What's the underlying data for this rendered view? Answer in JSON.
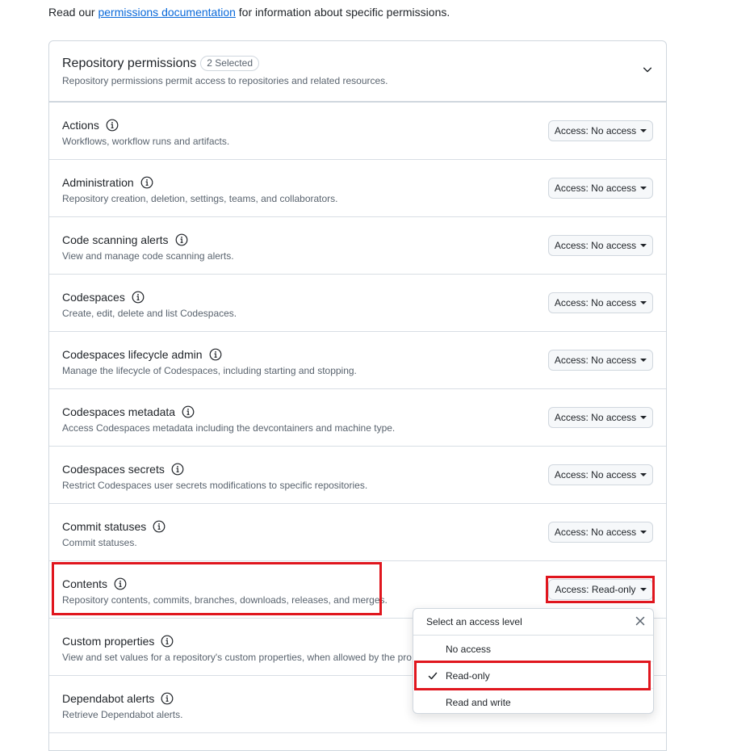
{
  "intro": {
    "before": "Read our ",
    "link": "permissions documentation",
    "after": " for information about specific permissions."
  },
  "panel": {
    "title": "Repository permissions",
    "badge": "2 Selected",
    "subtitle": "Repository permissions permit access to repositories and related resources."
  },
  "rows": [
    {
      "name": "Actions",
      "desc": "Workflows, workflow runs and artifacts.",
      "access": "Access: No access"
    },
    {
      "name": "Administration",
      "desc": "Repository creation, deletion, settings, teams, and collaborators.",
      "access": "Access: No access"
    },
    {
      "name": "Code scanning alerts",
      "desc": "View and manage code scanning alerts.",
      "access": "Access: No access"
    },
    {
      "name": "Codespaces",
      "desc": "Create, edit, delete and list Codespaces.",
      "access": "Access: No access"
    },
    {
      "name": "Codespaces lifecycle admin",
      "desc": "Manage the lifecycle of Codespaces, including starting and stopping.",
      "access": "Access: No access"
    },
    {
      "name": "Codespaces metadata",
      "desc": "Access Codespaces metadata including the devcontainers and machine type.",
      "access": "Access: No access"
    },
    {
      "name": "Codespaces secrets",
      "desc": "Restrict Codespaces user secrets modifications to specific repositories.",
      "access": "Access: No access"
    },
    {
      "name": "Commit statuses",
      "desc": "Commit statuses.",
      "access": "Access: No access"
    },
    {
      "name": "Contents",
      "desc": "Repository contents, commits, branches, downloads, releases, and merges.",
      "access": "Access: Read-only"
    },
    {
      "name": "Custom properties",
      "desc": "View and set values for a repository's custom properties, when allowed by the pro",
      "access": ""
    },
    {
      "name": "Dependabot alerts",
      "desc": "Retrieve Dependabot alerts.",
      "access": ""
    }
  ],
  "menu": {
    "title": "Select an access level",
    "options": [
      "No access",
      "Read-only",
      "Read and write"
    ],
    "selected": "Read-only"
  },
  "colors": {
    "link": "#0969da",
    "highlight": "#e0161e",
    "border": "#d0d7de",
    "muted_text": "#59636e"
  }
}
